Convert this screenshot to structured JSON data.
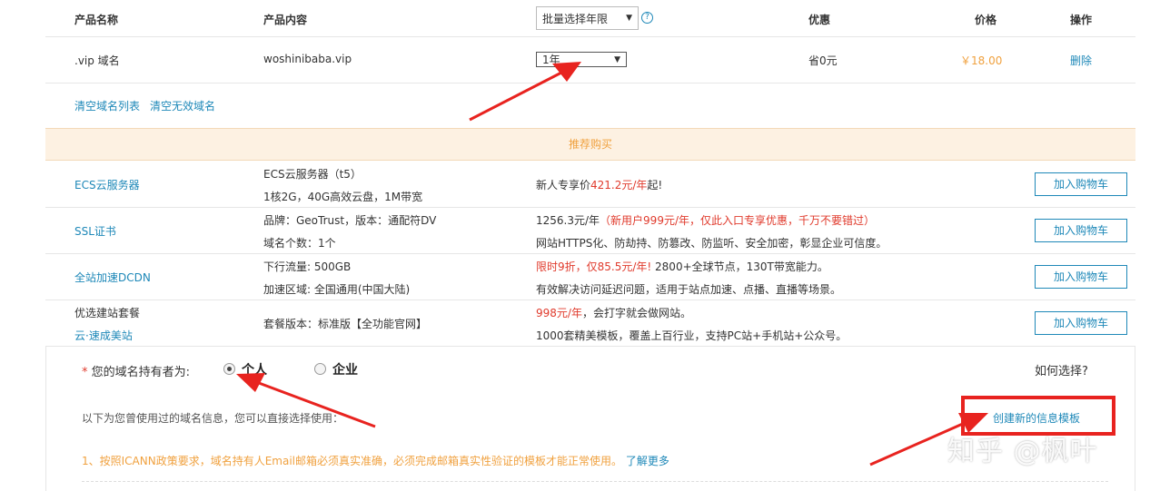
{
  "header": {
    "product_name": "产品名称",
    "product_content": "产品内容",
    "batch_select": "批量选择年限",
    "discount": "优惠",
    "price": "价格",
    "action": "操作",
    "help_icon": "?"
  },
  "cart_item": {
    "name": ".vip 域名",
    "content": "woshinibaba.vip",
    "years": "1年",
    "discount": "省0元",
    "price": "￥18.00",
    "delete": "删除"
  },
  "links": {
    "clear_list": "清空域名列表",
    "clear_invalid": "清空无效域名"
  },
  "recommend": {
    "title": "推荐购买",
    "add_to_cart": "加入购物车",
    "items": [
      {
        "name": "ECS云服务器",
        "line1": "ECS云服务器（t5）",
        "line2": "1核2G，40G高效云盘，1M带宽",
        "desc_prefix": "新人专享价",
        "desc_red": "421.2元/年",
        "desc_suffix": "起!"
      },
      {
        "name": "SSL证书",
        "line1": "品牌：GeoTrust，版本：通配符DV",
        "line2": "域名个数：1个",
        "desc_prefix": "1256.3元/年",
        "desc_red": "（新用户999元/年，仅此入口专享优惠，千万不要错过）",
        "desc2": "网站HTTPS化、防劫持、防篡改、防监听、安全加密，彰显企业可信度。"
      },
      {
        "name": "全站加速DCDN",
        "line1": "下行流量: 500GB",
        "line2": "加速区域: 全国通用(中国大陆)",
        "desc_red": "限时9折，仅85.5元/年!",
        "desc_suffix": " 2800+全球节点，130T带宽能力。",
        "desc2": "有效解决访问延迟问题，适用于站点加速、点播、直播等场景。"
      },
      {
        "name_line1": "优选建站套餐",
        "name_line2": "云·速成美站",
        "line1": "套餐版本：标准版【全功能官网】",
        "desc_red": "998元/年",
        "desc_suffix": "，会打字就会做网站。",
        "desc2": "1000套精美模板，覆盖上百行业，支持PC站+手机站+公众号。"
      }
    ]
  },
  "owner": {
    "required_mark": "*",
    "label": "您的域名持有者为:",
    "option_personal": "个人",
    "option_company": "企业",
    "selected": "个人",
    "how_to_choose": "如何选择?",
    "info_text": "以下为您曾使用过的域名信息，您可以直接选择使用：",
    "create_template": "创建新的信息模板",
    "notice": "1、按照ICANN政策要求，域名持有人Email邮箱必须真实准确，必须完成邮箱真实性验证的模板才能正常使用。",
    "learn_more": "了解更多"
  },
  "watermark": "知乎 @枫叶",
  "colors": {
    "link": "#1e88b8",
    "price_orange": "#f0a13f",
    "promo_red": "#e03a2c",
    "annotation_red": "#e8231f",
    "recommend_bg": "#fdf1e2"
  }
}
